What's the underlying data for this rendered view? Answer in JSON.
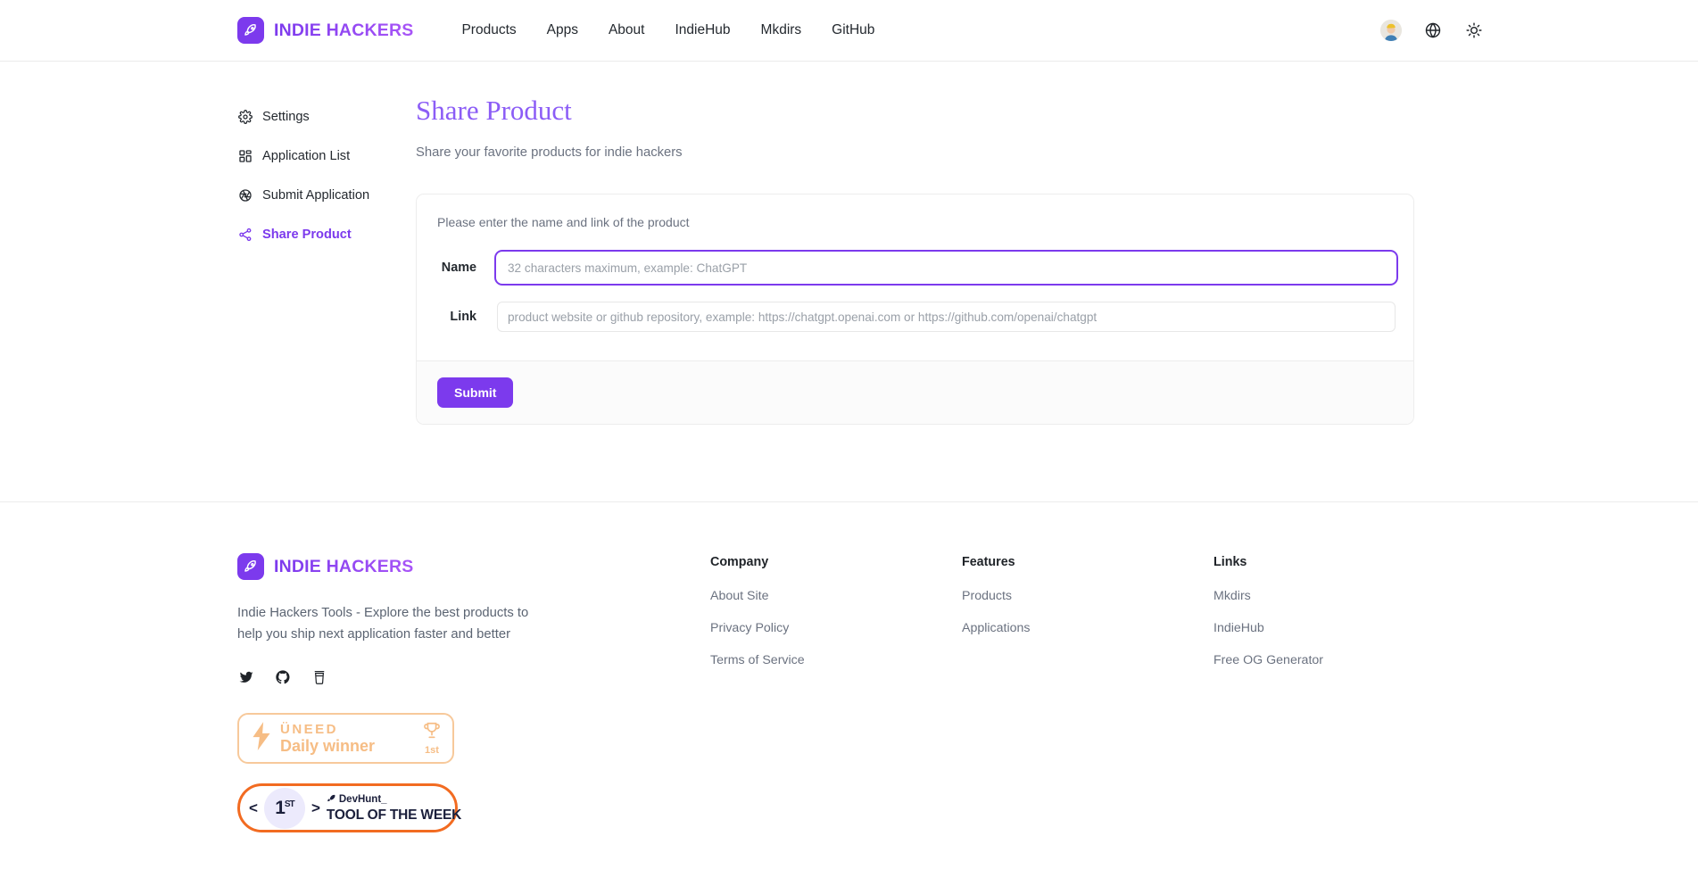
{
  "header": {
    "brand": "INDIE HACKERS",
    "logo_icon": "rocket-icon",
    "nav": [
      {
        "label": "Products"
      },
      {
        "label": "Apps"
      },
      {
        "label": "About"
      },
      {
        "label": "IndieHub"
      },
      {
        "label": "Mkdirs"
      },
      {
        "label": "GitHub"
      }
    ],
    "avatar_icon": "user-avatar",
    "language_icon": "globe-icon",
    "theme_icon": "sun-icon"
  },
  "sidebar": {
    "items": [
      {
        "label": "Settings",
        "icon": "gear-icon",
        "active": false
      },
      {
        "label": "Application List",
        "icon": "grid-icon",
        "active": false
      },
      {
        "label": "Submit Application",
        "icon": "aperture-icon",
        "active": false
      },
      {
        "label": "Share Product",
        "icon": "share-icon",
        "active": true
      }
    ]
  },
  "main": {
    "title": "Share Product",
    "subtitle": "Share your favorite products for indie hackers",
    "card": {
      "hint": "Please enter the name and link of the product",
      "fields": [
        {
          "label": "Name",
          "value": "",
          "placeholder": "32 characters maximum, example: ChatGPT",
          "focused": true
        },
        {
          "label": "Link",
          "value": "",
          "placeholder": "product website or github repository, example: https://chatgpt.openai.com or https://github.com/openai/chatgpt",
          "focused": false
        }
      ],
      "submit_label": "Submit"
    }
  },
  "footer": {
    "brand": "INDIE HACKERS",
    "description": "Indie Hackers Tools - Explore the best products to help you ship next application faster and better",
    "socials": [
      {
        "icon": "twitter-icon"
      },
      {
        "icon": "github-icon"
      },
      {
        "icon": "buymeacoffee-icon"
      }
    ],
    "badges": {
      "uneed": {
        "top_text": "ÜNEED",
        "bottom_text": "Daily winner",
        "rank": "1st",
        "icon": "lightning-icon",
        "trophy_icon": "trophy-icon"
      },
      "devhunt": {
        "rank": "1",
        "rank_suffix": "ST",
        "brand": "DevHunt_",
        "title": "TOOL OF THE WEEK",
        "icon": "rocket-icon"
      }
    },
    "columns": [
      {
        "title": "Company",
        "links": [
          {
            "label": "About Site"
          },
          {
            "label": "Privacy Policy"
          },
          {
            "label": "Terms of Service"
          }
        ]
      },
      {
        "title": "Features",
        "links": [
          {
            "label": "Products"
          },
          {
            "label": "Applications"
          }
        ]
      },
      {
        "title": "Links",
        "links": [
          {
            "label": "Mkdirs"
          },
          {
            "label": "IndieHub"
          },
          {
            "label": "Free OG Generator"
          }
        ]
      }
    ]
  },
  "colors": {
    "accent": "#7c3aed",
    "accent_light": "#a855f7",
    "uneed_orange": "#f6bd85",
    "devhunt_orange": "#f26b21",
    "text": "#24292f",
    "muted": "#6b7280"
  }
}
